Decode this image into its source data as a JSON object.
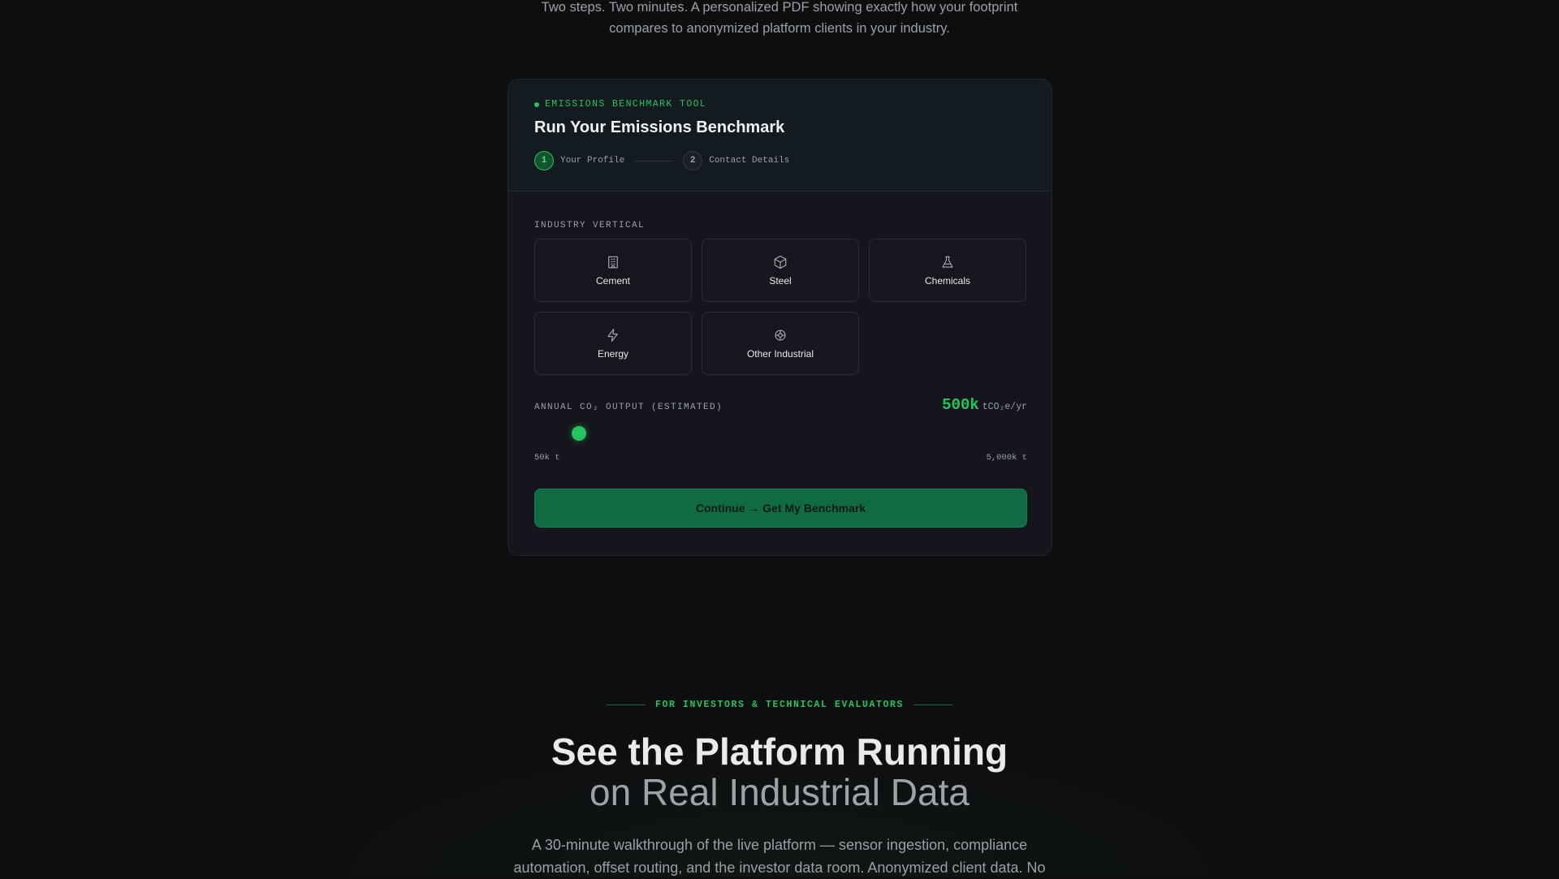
{
  "intro": {
    "line1": "Two steps. Two minutes. A personalized PDF showing exactly how your footprint",
    "line2": "compares to anonymized platform clients in your industry."
  },
  "card": {
    "eyebrow": "EMISSIONS BENCHMARK TOOL",
    "title": "Run Your Emissions Benchmark",
    "steps": [
      {
        "number": "1",
        "label": "Your Profile",
        "state": "active"
      },
      {
        "number": "2",
        "label": "Contact Details",
        "state": "inactive"
      }
    ],
    "industry_label": "INDUSTRY VERTICAL",
    "industries": [
      {
        "label": "Cement",
        "icon": "building-icon"
      },
      {
        "label": "Steel",
        "icon": "cube-icon"
      },
      {
        "label": "Chemicals",
        "icon": "flask-icon"
      },
      {
        "label": "Energy",
        "icon": "lightning-icon"
      },
      {
        "label": "Other Industrial",
        "icon": "gear-icon"
      }
    ],
    "co2": {
      "label": "ANNUAL CO₂ OUTPUT (ESTIMATED)",
      "value": "500k",
      "unit": "tCO₂e/yr",
      "slider_fraction": 0.0909,
      "min_label": "50k t",
      "max_label": "5,000k t"
    },
    "cta_label": "Continue → Get My Benchmark"
  },
  "section": {
    "eyebrow": "FOR INVESTORS & TECHNICAL EVALUATORS",
    "title_line1": "See the Platform Running",
    "title_line2": "on Real Industrial Data",
    "description": "A 30-minute walkthrough of the live platform — sensor ingestion, compliance automation, offset routing, and the investor data room. Anonymized client data. No"
  },
  "colors": {
    "accent": "#22c55e",
    "button": "#116b42",
    "background": "#0d0e10",
    "card": "#15161d"
  }
}
